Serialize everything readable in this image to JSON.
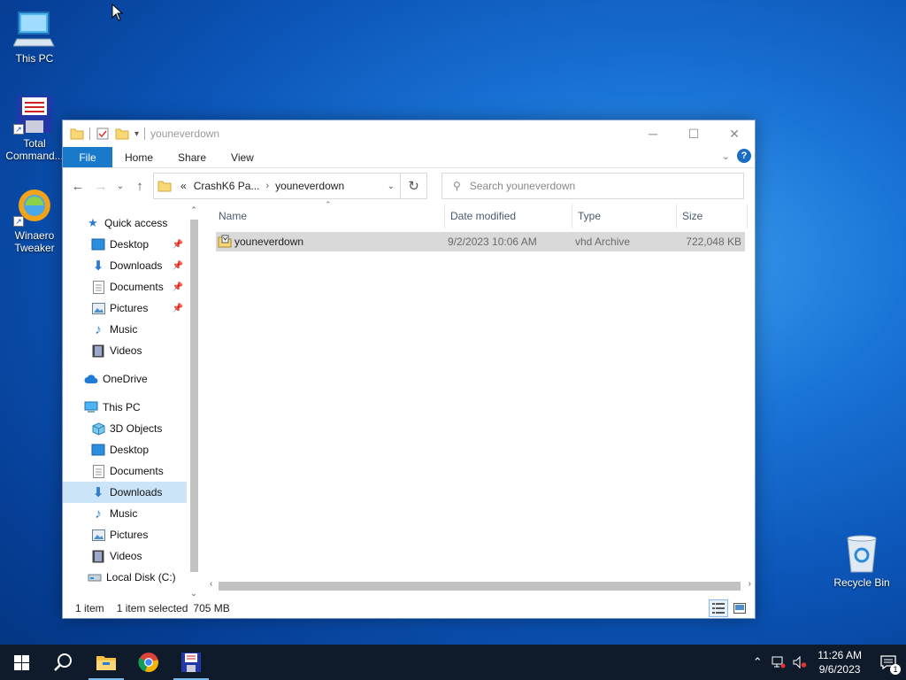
{
  "desktop": {
    "icons": [
      {
        "label": "This PC"
      },
      {
        "label": "Total Command..."
      },
      {
        "label": "Winaero Tweaker"
      },
      {
        "label": "Recycle Bin"
      }
    ]
  },
  "window": {
    "title": "youneverdown",
    "ribbon_tabs": [
      "File",
      "Home",
      "Share",
      "View"
    ],
    "address": {
      "overflow": "«",
      "crumbs": [
        "CrashK6 Pa...",
        "youneverdown"
      ]
    },
    "search_placeholder": "Search youneverdown",
    "nav": {
      "quick_access": "Quick access",
      "quick_items": [
        "Desktop",
        "Downloads",
        "Documents",
        "Pictures",
        "Music",
        "Videos"
      ],
      "onedrive": "OneDrive",
      "this_pc": "This PC",
      "pc_items": [
        "3D Objects",
        "Desktop",
        "Documents",
        "Downloads",
        "Music",
        "Pictures",
        "Videos",
        "Local Disk (C:)"
      ],
      "selected": "Downloads"
    },
    "columns": [
      "Name",
      "Date modified",
      "Type",
      "Size"
    ],
    "files": [
      {
        "name": "youneverdown",
        "date": "9/2/2023 10:06 AM",
        "type": "vhd Archive",
        "size": "722,048 KB"
      }
    ],
    "status": {
      "count": "1 item",
      "selection": "1 item selected",
      "size": "705 MB"
    }
  },
  "taskbar": {
    "time": "11:26 AM",
    "date": "9/6/2023",
    "notification_count": "1"
  },
  "colors": {
    "accent": "#1979ca",
    "selection": "#cce4f7",
    "taskbar": "#0f1a2b"
  }
}
